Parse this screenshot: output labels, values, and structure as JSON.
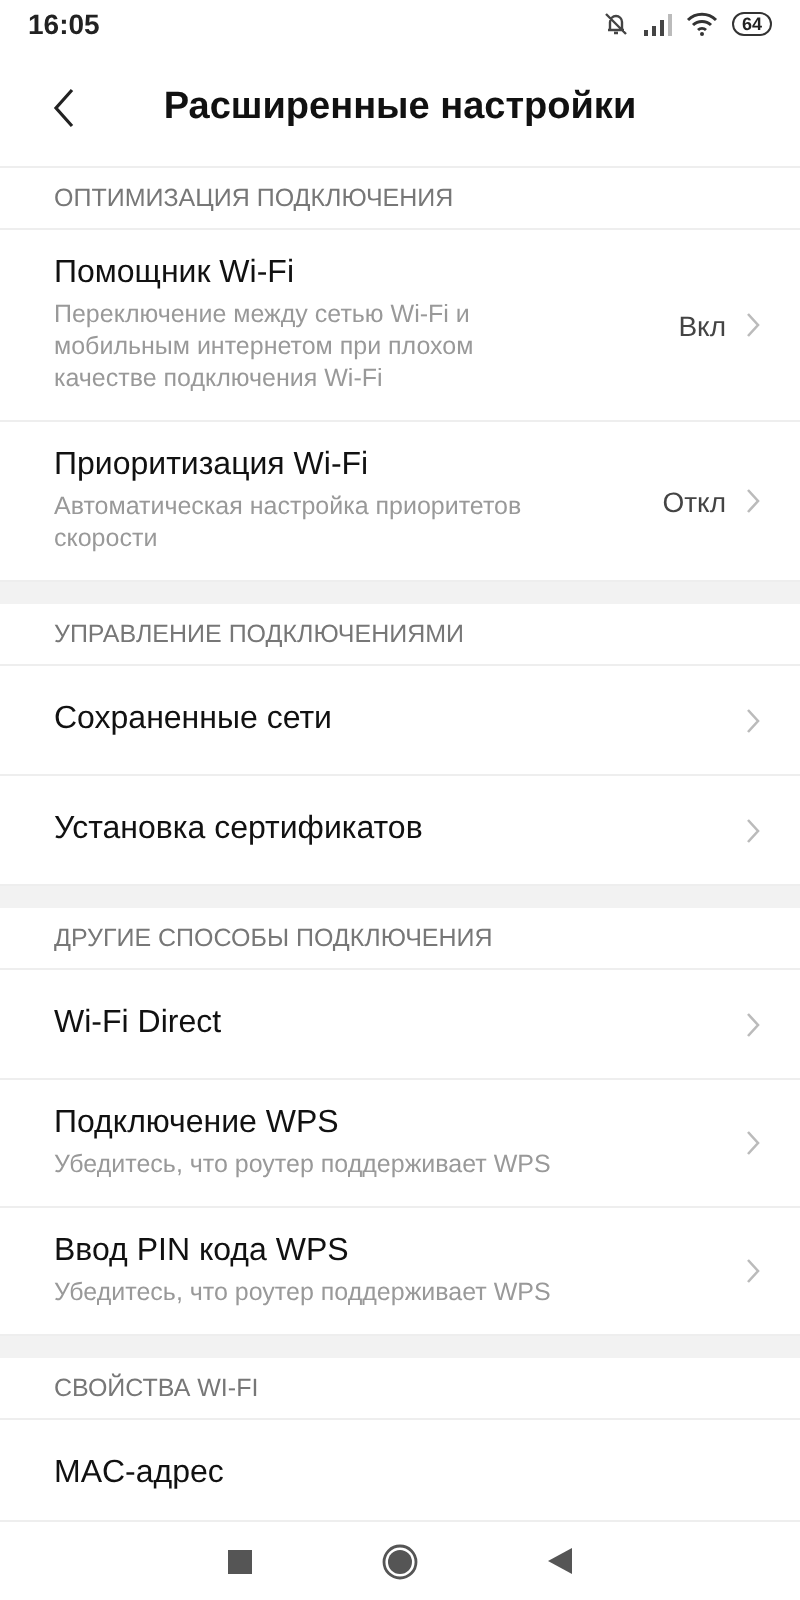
{
  "status_bar": {
    "time": "16:05",
    "battery": "64"
  },
  "header": {
    "title": "Расширенные настройки"
  },
  "sections": [
    {
      "header": "ОПТИМИЗАЦИЯ ПОДКЛЮЧЕНИЯ",
      "items": [
        {
          "title": "Помощник Wi-Fi",
          "subtitle": "Переключение между сетью Wi-Fi и мобильным интернетом при плохом качестве подключения Wi-Fi",
          "value": "Вкл",
          "chevron": true
        },
        {
          "title": "Приоритизация Wi-Fi",
          "subtitle": "Автоматическая настройка приоритетов скорости",
          "value": "Откл",
          "chevron": true
        }
      ]
    },
    {
      "header": "УПРАВЛЕНИЕ ПОДКЛЮЧЕНИЯМИ",
      "items": [
        {
          "title": "Сохраненные сети",
          "chevron": true
        },
        {
          "title": "Установка сертификатов",
          "chevron": true
        }
      ]
    },
    {
      "header": "ДРУГИЕ СПОСОБЫ ПОДКЛЮЧЕНИЯ",
      "items": [
        {
          "title": "Wi-Fi Direct",
          "chevron": true
        },
        {
          "title": "Подключение WPS",
          "subtitle": "Убедитесь, что роутер поддерживает WPS",
          "chevron": true
        },
        {
          "title": "Ввод PIN кода WPS",
          "subtitle": "Убедитесь, что роутер поддерживает WPS",
          "chevron": true
        }
      ]
    },
    {
      "header": "СВОЙСТВА WI-FI",
      "items": [
        {
          "title": "MAC-адрес",
          "chevron": false
        }
      ]
    }
  ]
}
